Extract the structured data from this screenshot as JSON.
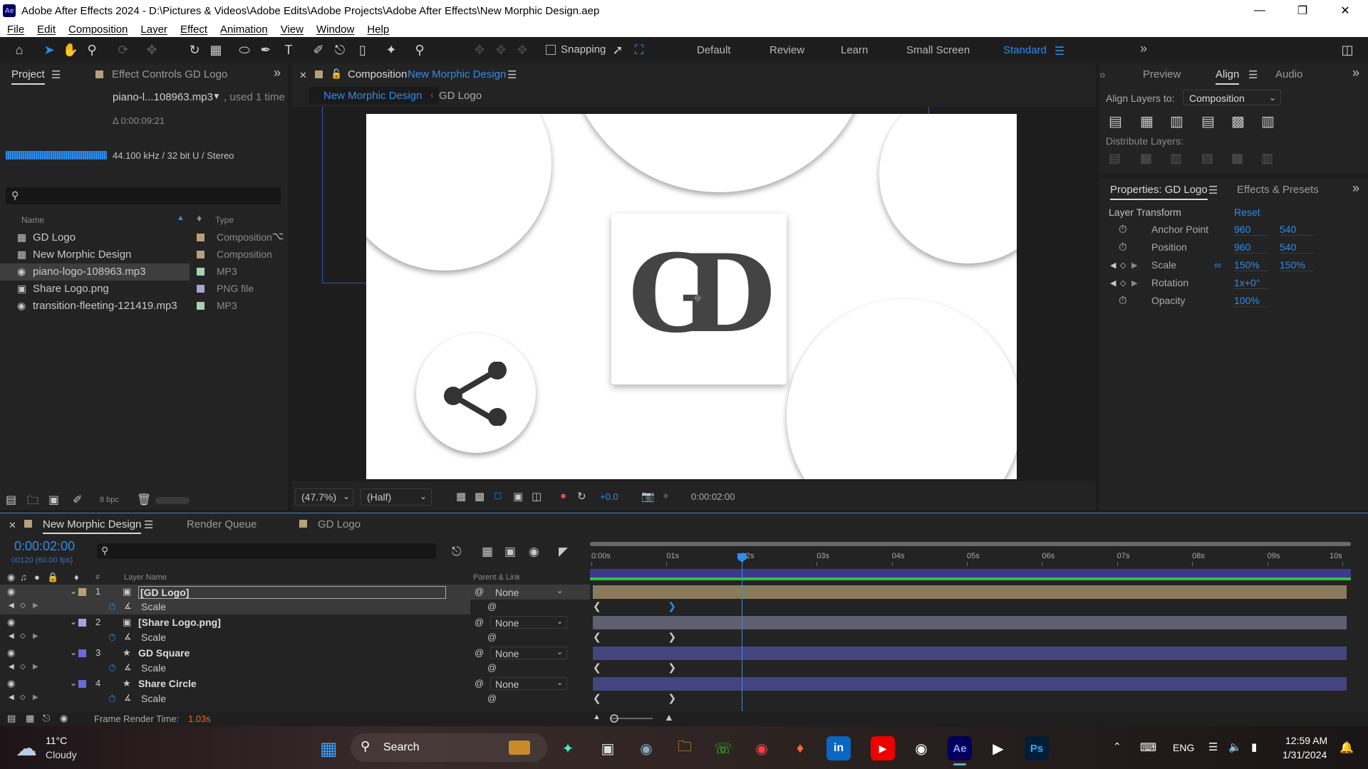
{
  "titlebar": {
    "title": "Adobe After Effects 2024 - D:\\Pictures & Videos\\Adobe Edits\\Adobe Projects\\Adobe After Effects\\New Morphic Design.aep",
    "logo": "Ae"
  },
  "menu": [
    "File",
    "Edit",
    "Composition",
    "Layer",
    "Effect",
    "Animation",
    "View",
    "Window",
    "Help"
  ],
  "toolbar": {
    "snapping_label": "Snapping",
    "workspaces": [
      "Default",
      "Review",
      "Learn",
      "Small Screen",
      "Standard"
    ],
    "active_workspace": "Standard"
  },
  "project_panel": {
    "tab_project": "Project",
    "tab_effect_controls": "Effect Controls GD Logo",
    "file_name": "piano-l...108963.mp3",
    "used": ", used 1 time",
    "duration": "Δ 0:00:09:21",
    "audio_info": "44.100 kHz / 32 bit U / Stereo",
    "col_name": "Name",
    "col_type": "Type",
    "items": [
      {
        "name": "GD Logo",
        "type": "Composition",
        "color": "#b4a07a",
        "icon": "comp-icon"
      },
      {
        "name": "New Morphic Design",
        "type": "Composition",
        "color": "#b4a07a",
        "icon": "comp-icon"
      },
      {
        "name": "piano-logo-108963.mp3",
        "type": "MP3",
        "color": "#a6d2b0",
        "icon": "audio-icon"
      },
      {
        "name": "Share Logo.png",
        "type": "PNG file",
        "color": "#a8a0d8",
        "icon": "image-icon"
      },
      {
        "name": "transition-fleeting-121419.mp3",
        "type": "MP3",
        "color": "#a6d2b0",
        "icon": "audio-icon"
      }
    ],
    "bpc": "8 bpc"
  },
  "composition_panel": {
    "tab_prefix": "Composition",
    "tab_name": "New Morphic Design",
    "breadcrumb": [
      "New Morphic Design",
      "GD Logo"
    ],
    "zoom": "(47.7%)",
    "resolution": "(Half)",
    "exposure": "+0.0",
    "timecode": "0:00:02:00",
    "logo_text": "GD"
  },
  "align_panel": {
    "tabs": [
      "Preview",
      "Align",
      "Audio"
    ],
    "active_tab": "Align",
    "align_to_label": "Align Layers to:",
    "align_to_value": "Composition",
    "distribute_label": "Distribute Layers:"
  },
  "properties_panel": {
    "tab": "Properties: GD Logo",
    "tab2": "Effects & Presets",
    "section": "Layer Transform",
    "reset": "Reset",
    "props": [
      {
        "name": "Anchor Point",
        "v1": "960",
        "v2": "540"
      },
      {
        "name": "Position",
        "v1": "960",
        "v2": "540"
      },
      {
        "name": "Scale",
        "v1": "150%",
        "v2": "150%"
      },
      {
        "name": "Rotation",
        "v1": "1x+0°",
        "v2": ""
      },
      {
        "name": "Opacity",
        "v1": "100%",
        "v2": ""
      }
    ]
  },
  "timeline": {
    "tab_comp": "New Morphic Design",
    "tab_render": "Render Queue",
    "tab_gd": "GD Logo",
    "timecode": "0:00:02:00",
    "frames": "00120 (60.00 fps)",
    "col_layer_name": "Layer Name",
    "col_parent": "Parent & Link",
    "ruler": [
      "0:00s",
      "01s",
      "02s",
      "03s",
      "04s",
      "05s",
      "06s",
      "07s",
      "08s",
      "09s",
      "10s"
    ],
    "playhead_seconds": 2,
    "duration_seconds": 10,
    "layers": [
      {
        "num": "1",
        "name": "[GD Logo]",
        "parent": "None",
        "prop": "Scale",
        "color": "#b4a07a",
        "bar": "#8a7a5c"
      },
      {
        "num": "2",
        "name": "[Share Logo.png]",
        "parent": "None",
        "prop": "Scale",
        "color": "#a8a0d8",
        "bar": "#5f5f6f"
      },
      {
        "num": "3",
        "name": "GD Square",
        "parent": "None",
        "prop": "Scale",
        "color": "#6a6ad8",
        "bar": "#44447e"
      },
      {
        "num": "4",
        "name": "Share Circle",
        "parent": "None",
        "prop": "Scale",
        "color": "#6a6ad8",
        "bar": "#44447e"
      }
    ],
    "frame_render_label": "Frame Render Time:",
    "frame_render_value": "1.03s"
  },
  "taskbar": {
    "temp": "11°C",
    "weather": "Cloudy",
    "search": "Search",
    "lang": "ENG",
    "time": "12:59 AM",
    "date": "1/31/2024"
  },
  "colors": {
    "accent": "#2d8ceb",
    "panel": "#232323",
    "bg": "#1d1d1d"
  }
}
